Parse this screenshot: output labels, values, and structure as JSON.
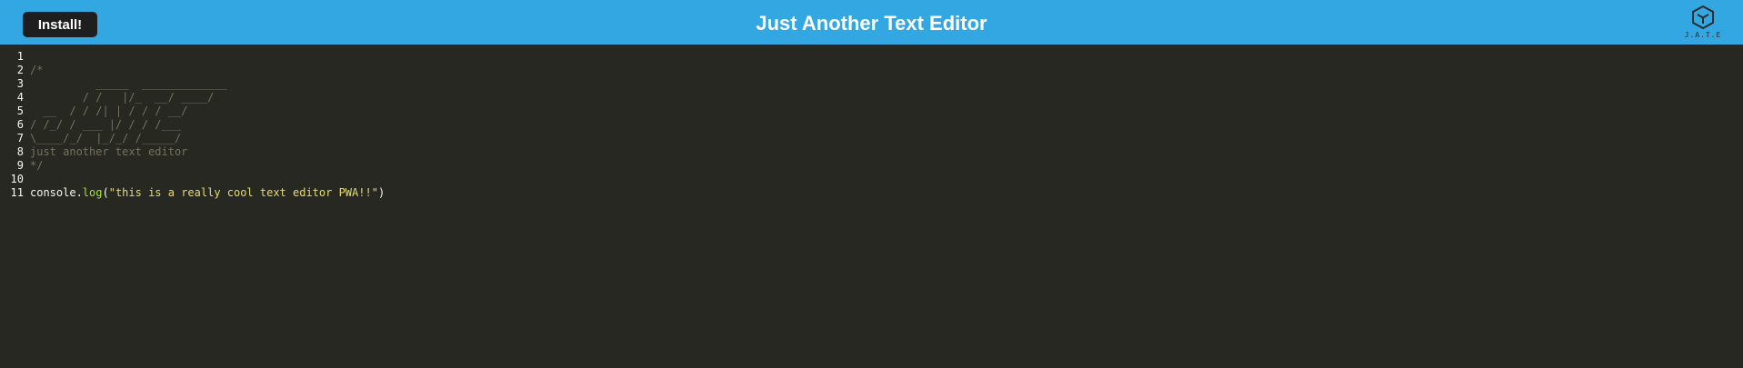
{
  "header": {
    "install_label": "Install!",
    "title": "Just Another Text Editor",
    "logo_icon": "cube-icon",
    "logo_text": "J.A.T.E",
    "background": "#33a7e2"
  },
  "editor": {
    "theme_background": "#272822",
    "lines": [
      {
        "number": "1",
        "text": ""
      },
      {
        "number": "2",
        "text": "/*"
      },
      {
        "number": "3",
        "text": "          _____  _____________"
      },
      {
        "number": "4",
        "text": "        / /   |/_  __/ ____/"
      },
      {
        "number": "5",
        "text": "  __  / / /| | / / / __/"
      },
      {
        "number": "6",
        "text": "/ /_/ / ___ |/ / / /___"
      },
      {
        "number": "7",
        "text": "\\____/_/  |_/_/ /_____/"
      },
      {
        "number": "8",
        "text": "just another text editor"
      },
      {
        "number": "9",
        "text": "*/"
      },
      {
        "number": "10",
        "text": ""
      },
      {
        "number": "11",
        "parts": {
          "obj": "console.",
          "fn": "log",
          "open": "(",
          "str": "\"this is a really cool text editor PWA!!\"",
          "close": ")"
        }
      }
    ]
  }
}
